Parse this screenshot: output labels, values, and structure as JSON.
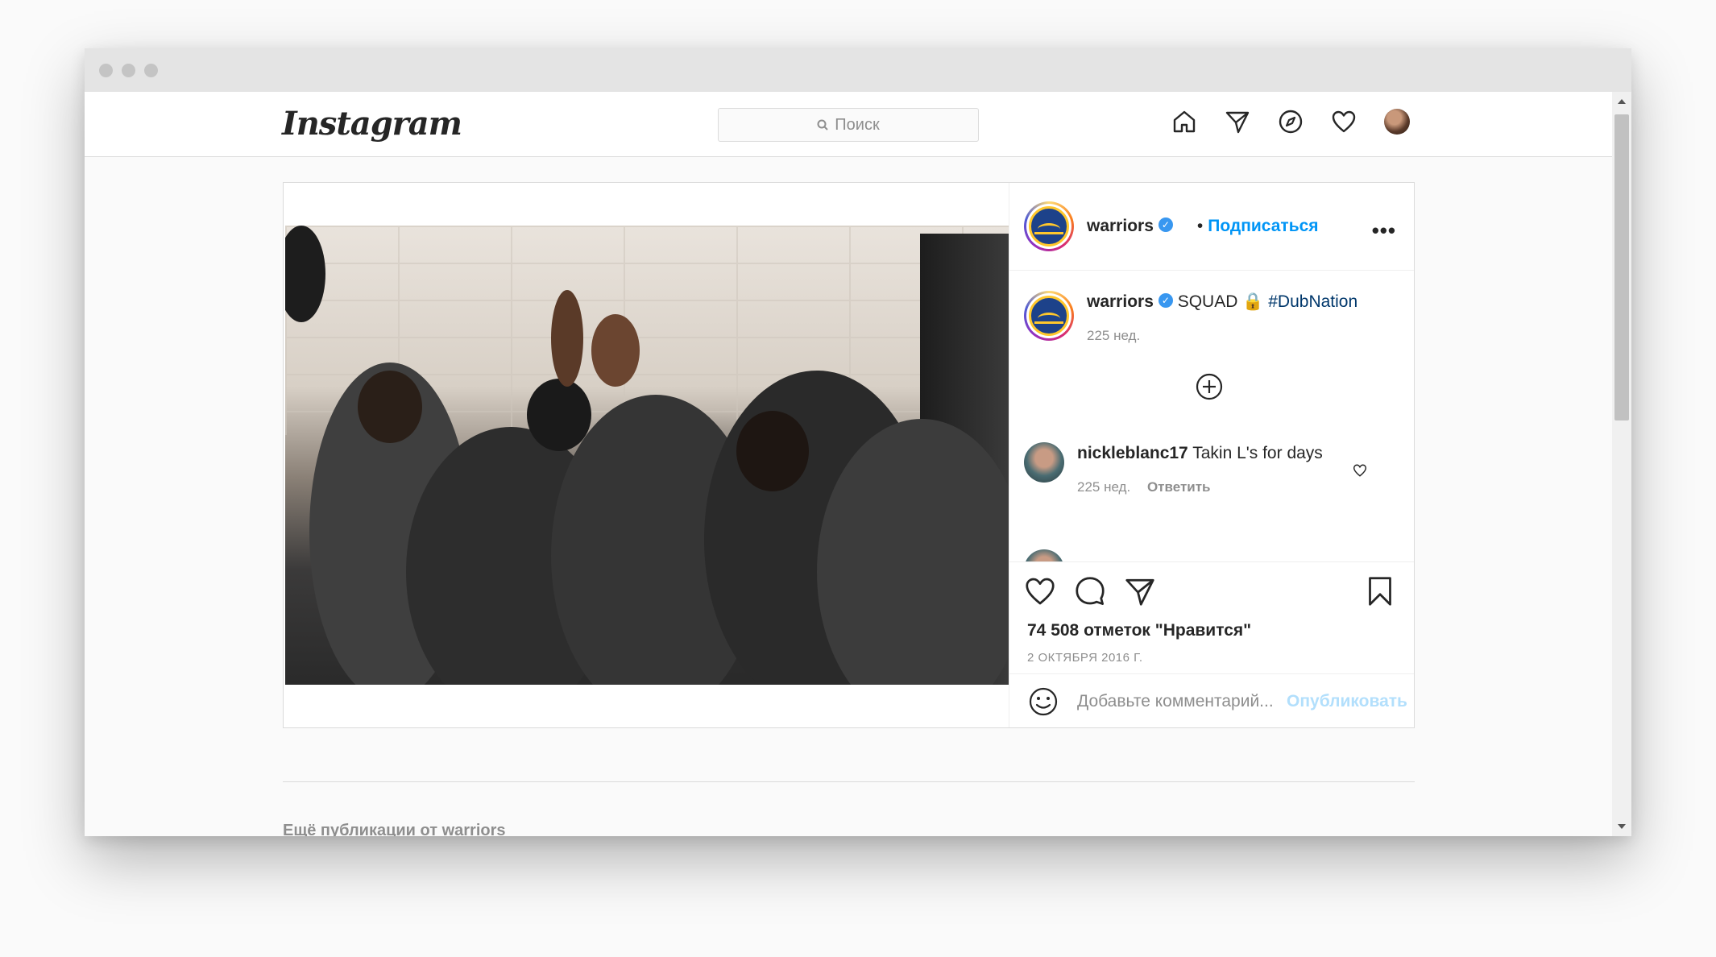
{
  "header": {
    "logo": "Instagram",
    "search_placeholder": "Поиск"
  },
  "post": {
    "author": "warriors",
    "follow_label": "Подписаться",
    "more_label": "•••",
    "caption": {
      "username": "warriors",
      "text": "SQUAD 🔒",
      "hashtag": "#DubNation",
      "age": "225 нед."
    },
    "comments": [
      {
        "username": "nickleblanc17",
        "text": "Takin L's for days",
        "age": "225 нед.",
        "reply_label": "Ответить"
      }
    ],
    "likes": "74 508 отметок \"Нравится\"",
    "date": "2 ОКТЯБРЯ 2016 Г.",
    "add_comment_placeholder": "Добавьте комментарий...",
    "publish_label": "Опубликовать"
  },
  "more_posts_label": "Ещё публикации от warriors"
}
